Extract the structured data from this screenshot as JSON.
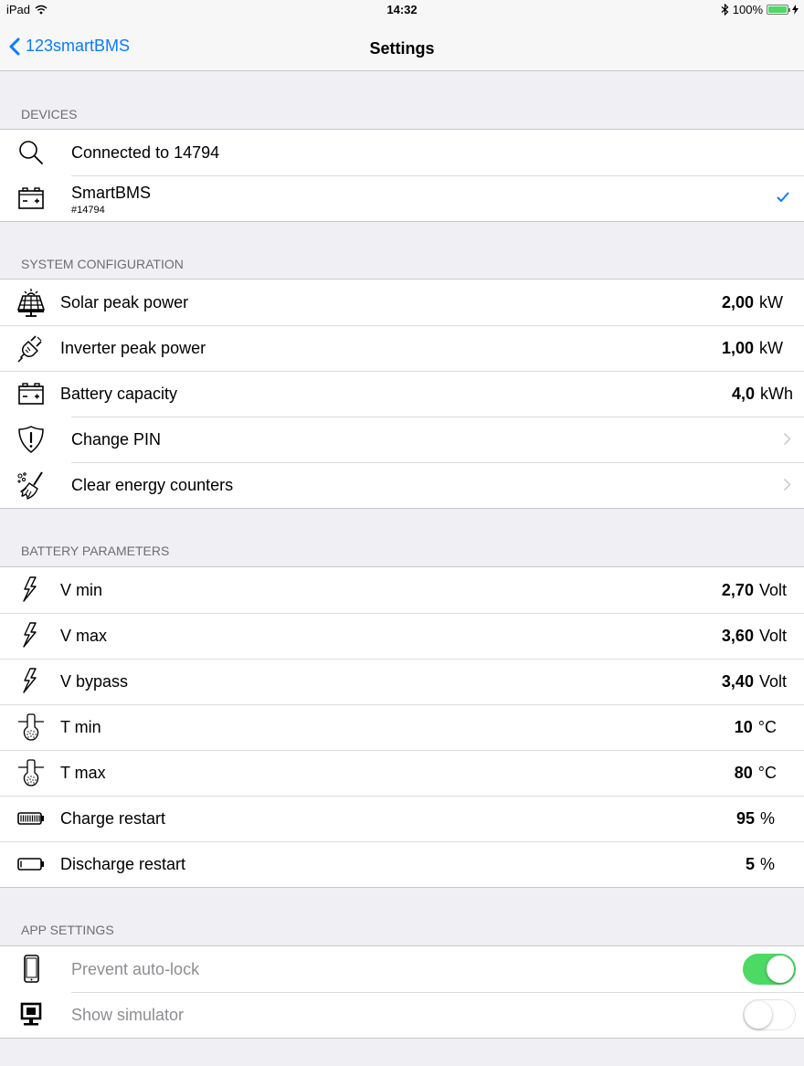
{
  "status_bar": {
    "device": "iPad",
    "time": "14:32",
    "battery": "100%",
    "battery_level": 1.0
  },
  "nav": {
    "back_label": "123smartBMS",
    "title": "Settings"
  },
  "devices": {
    "header": "DEVICES",
    "connected": {
      "icon": "search-icon",
      "label": "Connected to 14794"
    },
    "device": {
      "icon": "battery-terminal-icon",
      "name": "SmartBMS",
      "serial": "#14794",
      "selected": true
    }
  },
  "system_configuration": {
    "header": "SYSTEM CONFIGURATION",
    "solar": {
      "icon": "solar-panel-icon",
      "label": "Solar peak power",
      "value": "2,00",
      "unit": "kW"
    },
    "inverter": {
      "icon": "plug-icon",
      "label": "Inverter peak power",
      "value": "1,00",
      "unit": "kW"
    },
    "battery": {
      "icon": "battery-terminal-icon",
      "label": "Battery capacity",
      "value": "4,0",
      "unit": "kWh"
    },
    "pin": {
      "icon": "shield-alert-icon",
      "label": "Change PIN"
    },
    "clear": {
      "icon": "broom-icon",
      "label": "Clear energy counters"
    }
  },
  "battery_parameters": {
    "header": "BATTERY PARAMETERS",
    "vmin": {
      "icon": "lightning-icon",
      "label": "V min",
      "value": "2,70",
      "unit": "Volt"
    },
    "vmax": {
      "icon": "lightning-icon",
      "label": "V max",
      "value": "3,60",
      "unit": "Volt"
    },
    "vbypass": {
      "icon": "lightning-icon",
      "label": "V bypass",
      "value": "3,40",
      "unit": "Volt"
    },
    "tmin": {
      "icon": "temperature-sensor-icon",
      "label": "T min",
      "value": "10",
      "unit": "°C"
    },
    "tmax": {
      "icon": "temperature-sensor-icon",
      "label": "T max",
      "value": "80",
      "unit": "°C"
    },
    "charge": {
      "icon": "battery-full-icon",
      "label": "Charge restart",
      "value": "95",
      "unit": "%"
    },
    "discharge": {
      "icon": "battery-empty-icon",
      "label": "Discharge restart",
      "value": "5",
      "unit": "%"
    }
  },
  "app_settings": {
    "header": "APP SETTINGS",
    "autolock": {
      "icon": "phone-icon",
      "label": "Prevent auto-lock",
      "enabled": true
    },
    "simulator": {
      "icon": "monitor-icon",
      "label": "Show simulator",
      "enabled": false
    }
  },
  "colors": {
    "accent": "#0a7bff",
    "switch_on": "#4cd964",
    "background": "#efeff4"
  }
}
